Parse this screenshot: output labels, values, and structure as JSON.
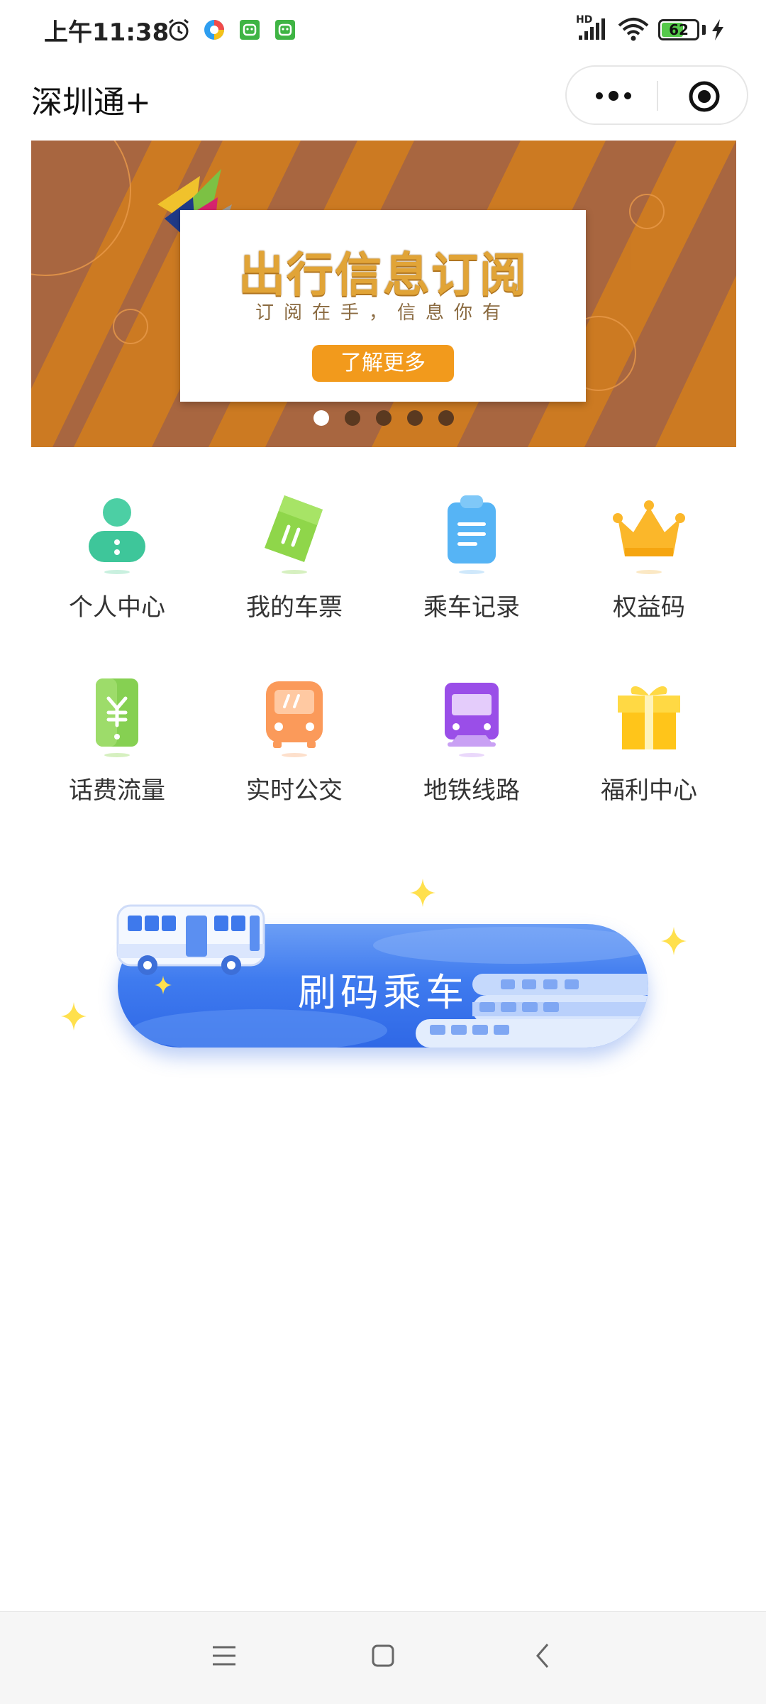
{
  "status_bar": {
    "time": "上午11:38",
    "battery": "62",
    "battery_level": 0.62,
    "network_label": "HD",
    "icons": [
      "alarm-icon",
      "browser-app-icon",
      "android-app-icon",
      "android-app-icon",
      "signal-icon",
      "wifi-icon",
      "battery-icon",
      "charging-icon"
    ]
  },
  "header": {
    "title": "深圳通+",
    "capsule": [
      "more-dots-icon",
      "close-target-icon"
    ]
  },
  "banner": {
    "title": "出行信息订阅",
    "subtitle": "订阅在手，信息你有",
    "button": "了解更多",
    "slide_count": 5,
    "active_slide": 1,
    "colors": {
      "background": "#a86640",
      "stripe": "#d07d1f",
      "button": "#f29a1c"
    }
  },
  "grid": [
    {
      "label": "个人中心",
      "icon": "user-icon"
    },
    {
      "label": "我的车票",
      "icon": "ticket-icon"
    },
    {
      "label": "乘车记录",
      "icon": "clipboard-icon"
    },
    {
      "label": "权益码",
      "icon": "crown-icon"
    },
    {
      "label": "话费流量",
      "icon": "phone-yuan-icon"
    },
    {
      "label": "实时公交",
      "icon": "bus-icon"
    },
    {
      "label": "地铁线路",
      "icon": "metro-icon"
    },
    {
      "label": "福利中心",
      "icon": "gift-icon"
    }
  ],
  "ride": {
    "label": "刷码乘车",
    "colors": {
      "button": "#3f7bef",
      "sparkle": "#ffe04d"
    }
  },
  "navbar": [
    "menu-icon",
    "home-icon",
    "back-icon"
  ]
}
